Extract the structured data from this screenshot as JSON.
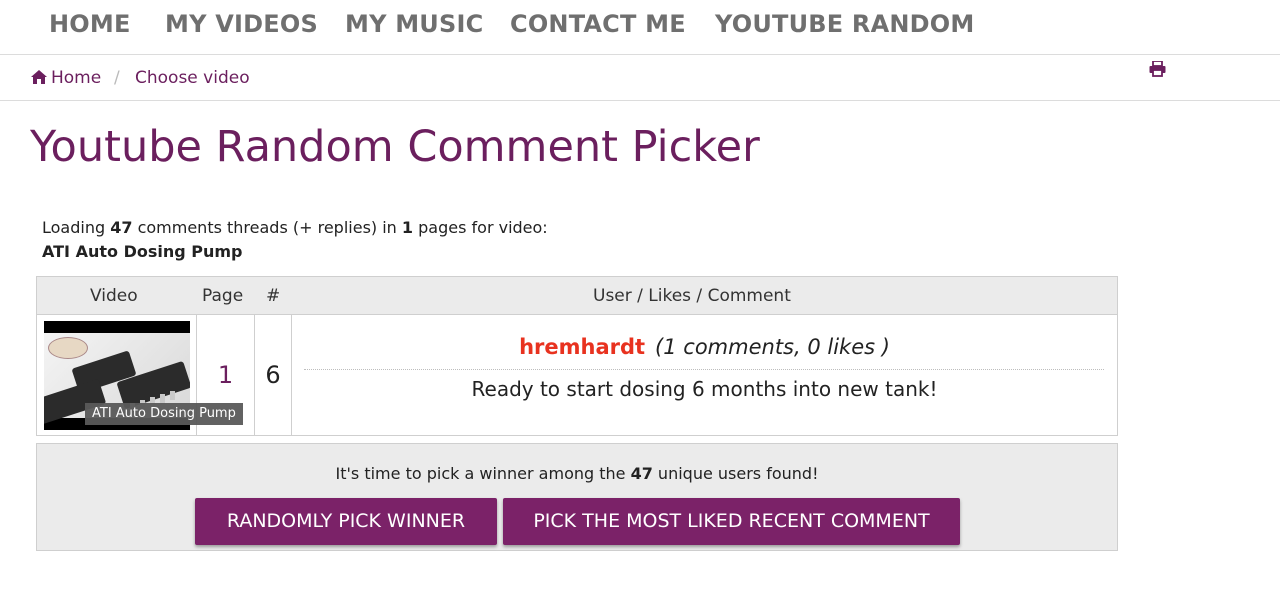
{
  "nav": {
    "items": [
      {
        "label": "HOME"
      },
      {
        "label": "MY VIDEOS"
      },
      {
        "label": "MY MUSIC"
      },
      {
        "label": "CONTACT ME"
      },
      {
        "label": "YOUTUBE RANDOM"
      }
    ]
  },
  "breadcrumb": {
    "home_icon": "home-icon",
    "home_label": "Home",
    "separator": "/",
    "current": "Choose video",
    "print_icon": "print-icon"
  },
  "page": {
    "title": "Youtube Random Comment Picker"
  },
  "loading": {
    "prefix": "Loading ",
    "thread_count": "47",
    "middle": " comments threads (+ replies) in ",
    "page_count": "1",
    "suffix": " pages for video:",
    "video_name": "ATI Auto Dosing Pump"
  },
  "table": {
    "headers": {
      "video": "Video",
      "page": "Page",
      "num": "#",
      "comment": "User / Likes / Comment"
    },
    "row": {
      "thumbnail_label": "ATI Auto Dosing Pump",
      "page": "1",
      "num": "6",
      "username": "hremhardt",
      "stats": "(1 comments, 0 likes )",
      "comment": "Ready to start dosing 6 months into new tank!"
    }
  },
  "action": {
    "text_prefix": "It's time to pick a winner among the ",
    "user_count": "47",
    "text_suffix": " unique users found!",
    "random_button": "RANDOMLY PICK WINNER",
    "liked_button": "PICK THE MOST LIKED RECENT COMMENT"
  },
  "colors": {
    "brand": "#6b1f5e",
    "button": "#7b2268",
    "username": "#e8321f",
    "nav_text": "#6f6f6f"
  }
}
